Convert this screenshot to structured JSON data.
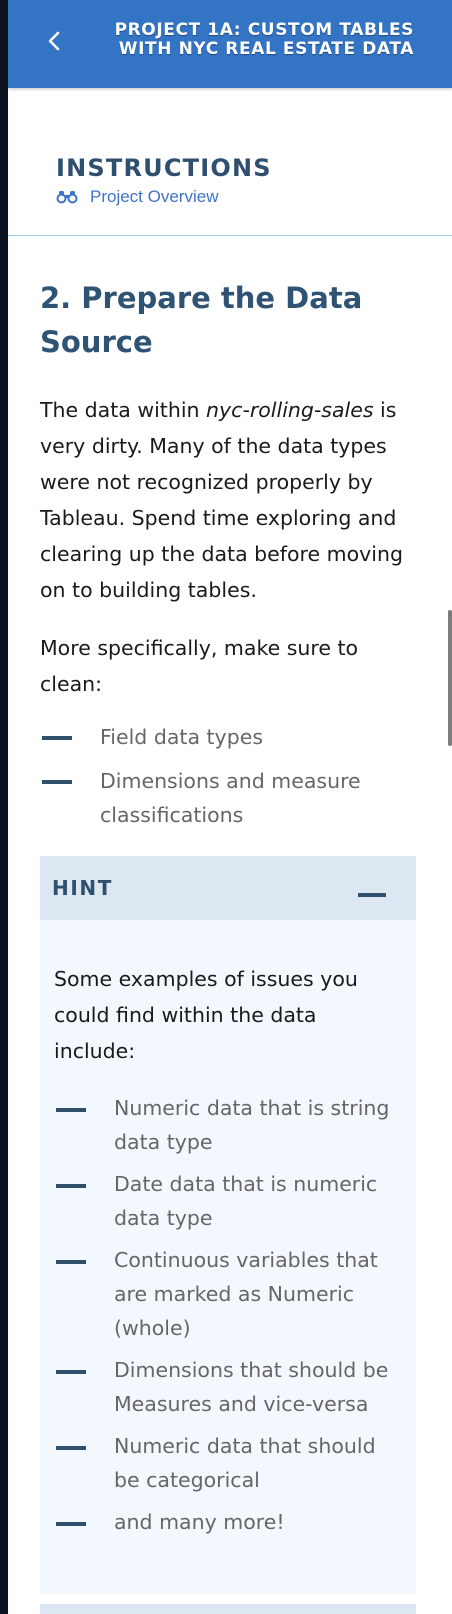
{
  "header": {
    "title_line1": "PROJECT 1A: CUSTOM TABLES",
    "title_line2": "WITH NYC REAL ESTATE DATA"
  },
  "instructions": {
    "title": "INSTRUCTIONS",
    "overview_link": "Project Overview",
    "overview_icon": "binoculars-icon"
  },
  "section": {
    "title": "2. Prepare the Data Source",
    "intro_before": "The data within ",
    "intro_dataset": "nyc-rolling-sales",
    "intro_after": " is very dirty. Many of the data types were not recognized properly by Tableau. Spend time exploring and clearing up the data before moving on to building tables.",
    "clean_intro": "More specifically, make sure to clean:",
    "clean_items": [
      "Field data types",
      "Dimensions and measure classifications"
    ]
  },
  "hint": {
    "label": "HINT",
    "intro": "Some examples of issues you could find within the data include:",
    "items": [
      "Numeric data that is string data type",
      "Date data that is numeric data type",
      "Continuous variables that are marked as Numeric (whole)",
      "Dimensions that should be Measures and vice-versa",
      "Numeric data that should be categorical",
      "and many more!"
    ]
  },
  "colors": {
    "header_bg": "#3374c4",
    "heading": "#2f5374",
    "link": "#3f73c8",
    "hint_bg": "#f2f8fd",
    "hint_header_bg": "#dce7f1"
  }
}
